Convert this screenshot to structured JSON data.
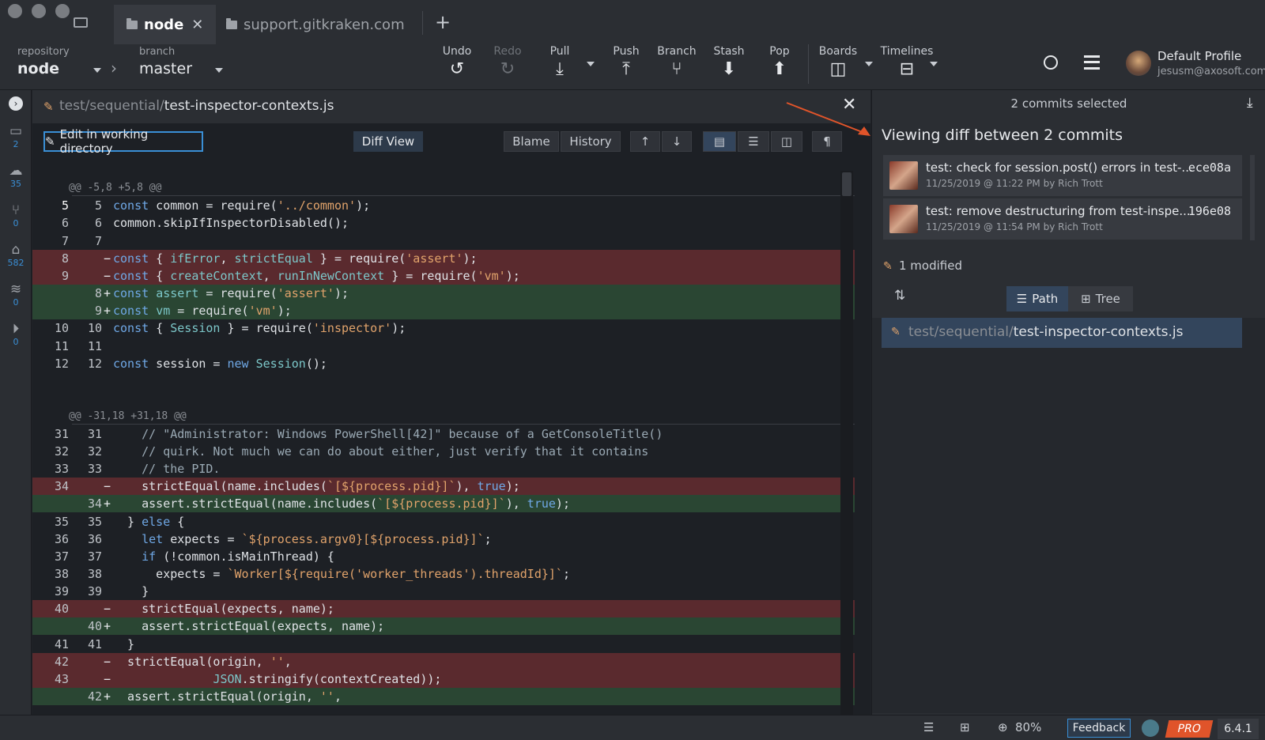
{
  "tabs": [
    {
      "label": "node",
      "active": true
    },
    {
      "label": "support.gitkraken.com",
      "active": false
    }
  ],
  "toolbar": {
    "repository_label": "repository",
    "repository_value": "node",
    "branch_label": "branch",
    "branch_value": "master",
    "undo": "Undo",
    "redo": "Redo",
    "pull": "Pull",
    "push": "Push",
    "branch": "Branch",
    "stash": "Stash",
    "pop": "Pop",
    "boards": "Boards",
    "timelines": "Timelines",
    "profile_name": "Default Profile",
    "profile_email": "jesusm@axosoft.com"
  },
  "leftrail": {
    "local_count": "2",
    "remote_count": "35",
    "pr_count": "0",
    "tags_count": "582",
    "stashes_count": "0",
    "actions_count": "0"
  },
  "diff": {
    "path_dir": "test/sequential/",
    "path_file": "test-inspector-contexts.js",
    "edit_label": "Edit in working directory",
    "diffview_label": "Diff View",
    "blame_label": "Blame",
    "history_label": "History",
    "hunk1": "@@ -5,8 +5,8 @@",
    "hunk2": "@@ -31,18 +31,18 @@"
  },
  "right": {
    "selected_header": "2 commits selected",
    "viewing_title": "Viewing diff between 2 commits",
    "commits": [
      {
        "message": "test: check for session.post() errors in test-...",
        "meta": "11/25/2019 @ 11:22 PM by Rich Trott",
        "sha": "ece08a"
      },
      {
        "message": "test: remove destructuring from test-inspe...",
        "meta": "11/25/2019 @ 11:54 PM by Rich Trott",
        "sha": "196e08"
      }
    ],
    "modified_label": "1 modified",
    "path_btn": "Path",
    "tree_btn": "Tree",
    "file_dir": "test/sequential/",
    "file_name": "test-inspector-contexts.js"
  },
  "status": {
    "zoom": "80%",
    "feedback": "Feedback",
    "pro": "PRO",
    "version": "6.4.1"
  },
  "colors": {
    "accent": "#3a8fd6",
    "deleted_bg": "#5a2a2e",
    "added_bg": "#2a4633",
    "pro_badge": "#e0542a"
  }
}
